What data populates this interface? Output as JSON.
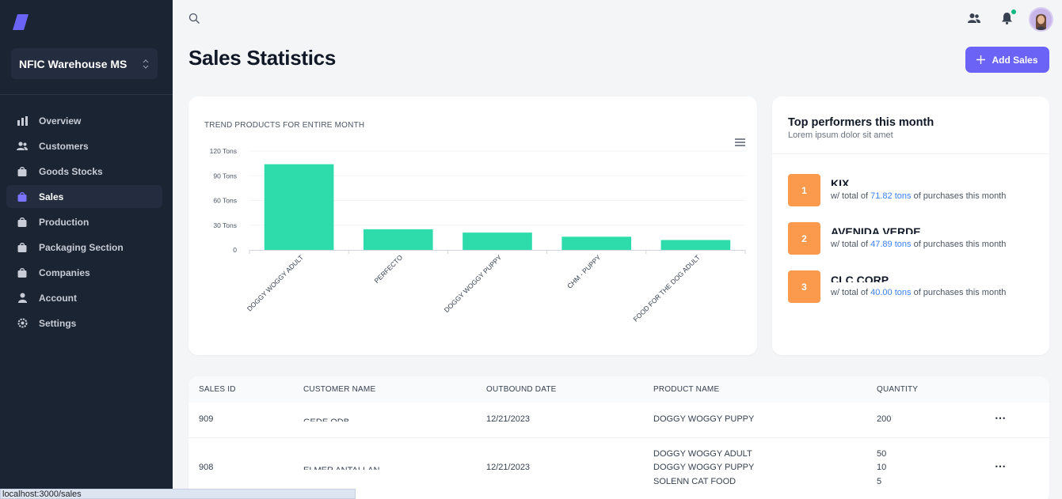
{
  "sidebar": {
    "workspace": "NFIC Warehouse MS",
    "items": [
      {
        "label": "Overview",
        "icon": "bar-chart-icon",
        "active": false
      },
      {
        "label": "Customers",
        "icon": "users-icon",
        "active": false
      },
      {
        "label": "Goods Stocks",
        "icon": "bag-icon",
        "active": false
      },
      {
        "label": "Sales",
        "icon": "bag-icon",
        "active": true
      },
      {
        "label": "Production",
        "icon": "bag-icon",
        "active": false
      },
      {
        "label": "Packaging Section",
        "icon": "bag-icon",
        "active": false
      },
      {
        "label": "Companies",
        "icon": "bag-icon",
        "active": false
      },
      {
        "label": "Account",
        "icon": "user-icon",
        "active": false
      },
      {
        "label": "Settings",
        "icon": "gear-icon",
        "active": false
      }
    ]
  },
  "header": {
    "title": "Sales Statistics",
    "add_button": "Add Sales"
  },
  "chart_data": {
    "type": "bar",
    "title": "TREND PRODUCTS FOR ENTIRE MONTH",
    "categories": [
      "DOGGY WOGGY ADULT",
      "PERFECTO",
      "DOGGY WOGGY PUPPY",
      "CHM - PUPPY",
      "FOOD FOR THE DOG ADULT"
    ],
    "values": [
      104,
      25,
      21,
      16,
      12
    ],
    "ytick_labels": [
      "0",
      "30 Tons",
      "60 Tons",
      "90 Tons",
      "120 Tons"
    ],
    "ylim": [
      0,
      120
    ],
    "color": "#2ddcaa",
    "grid": true
  },
  "performers": {
    "title": "Top performers this month",
    "subtitle": "Lorem ipsum dolor sit amet",
    "items": [
      {
        "rank": "1",
        "name": "KIX",
        "prefix": "w/ total of ",
        "amount": "71.82 tons",
        "suffix": " of purchases this month"
      },
      {
        "rank": "2",
        "name": "AVENIDA VERDE",
        "prefix": "w/ total of ",
        "amount": "47.89 tons",
        "suffix": " of purchases this month"
      },
      {
        "rank": "3",
        "name": "CLC CORP",
        "prefix": "w/ total of ",
        "amount": "40.00 tons",
        "suffix": " of purchases this month"
      }
    ]
  },
  "table": {
    "columns": [
      "SALES ID",
      "CUSTOMER NAME",
      "OUTBOUND DATE",
      "PRODUCT NAME",
      "QUANTITY"
    ],
    "rows": [
      {
        "id": "909",
        "customer": "GEDE ODB",
        "date": "12/21/2023",
        "products": [
          "DOGGY WOGGY PUPPY"
        ],
        "quantities": [
          "200"
        ]
      },
      {
        "id": "908",
        "customer": "ELMER ANTALLAN",
        "date": "12/21/2023",
        "products": [
          "DOGGY WOGGY ADULT",
          "DOGGY WOGGY PUPPY",
          "SOLENN CAT FOOD"
        ],
        "quantities": [
          "50",
          "10",
          "5"
        ]
      }
    ]
  },
  "status_url": "localhost:3000/sales"
}
